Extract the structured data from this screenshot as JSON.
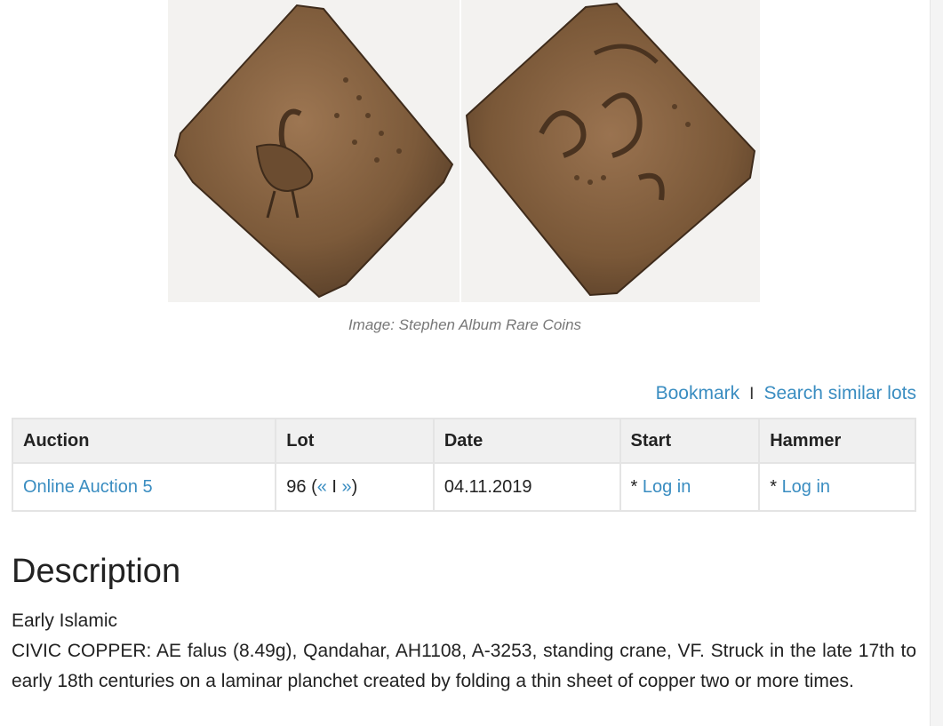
{
  "image": {
    "caption": "Image: Stephen Album Rare Coins",
    "obverse_alt": "coin obverse",
    "reverse_alt": "coin reverse"
  },
  "actions": {
    "bookmark": "Bookmark",
    "separator": "I",
    "search_similar": "Search similar lots"
  },
  "table": {
    "headers": {
      "auction": "Auction",
      "lot": "Lot",
      "date": "Date",
      "start": "Start",
      "hammer": "Hammer"
    },
    "row": {
      "auction": "Online Auction 5",
      "lot_number": "96 (",
      "prev": "«",
      "nav_sep": " I ",
      "next": "»",
      "lot_close": ")",
      "date": "04.11.2019",
      "start_prefix": "* ",
      "start_link": "Log in",
      "hammer_prefix": "* ",
      "hammer_link": "Log in"
    }
  },
  "description": {
    "heading": "Description",
    "category": "Early Islamic",
    "body": "CIVIC COPPER: AE falus (8.49g), Qandahar, AH1108, A-3253, standing crane, VF. Struck in the late 17th to early 18th centuries on a laminar planchet created by folding a thin sheet of copper two or more times."
  },
  "colors": {
    "link": "#3a8dc1",
    "coin_bronze": "#8a6440",
    "header_bg": "#f0f0f0"
  }
}
